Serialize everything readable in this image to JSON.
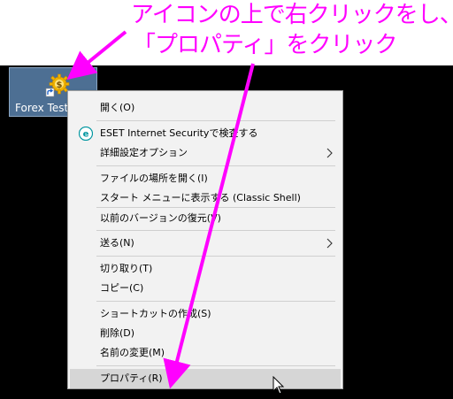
{
  "annotation": {
    "line1": "アイコンの上で右クリックをし、",
    "line2": "「プロパティ」をクリック",
    "color": "#ff00ff"
  },
  "desktop_icon": {
    "label": "Forex Tester",
    "icon": "gear-dollar-shortcut-icon"
  },
  "menu": {
    "items": [
      {
        "label": "開く(O)"
      },
      {
        "label": "ESET Internet Securityで検査する",
        "icon": "eset-icon"
      },
      {
        "label": "詳細設定オプション",
        "submenu": true
      },
      {
        "label": "ファイルの場所を開く(I)"
      },
      {
        "label": "スタート メニューに表示する (Classic Shell)"
      },
      {
        "label": "以前のバージョンの復元(V)"
      },
      {
        "label": "送る(N)",
        "submenu": true
      },
      {
        "label": "切り取り(T)"
      },
      {
        "label": "コピー(C)"
      },
      {
        "label": "ショートカットの作成(S)"
      },
      {
        "label": "削除(D)"
      },
      {
        "label": "名前の変更(M)"
      },
      {
        "label": "プロパティ(R)",
        "highlighted": true
      }
    ]
  }
}
